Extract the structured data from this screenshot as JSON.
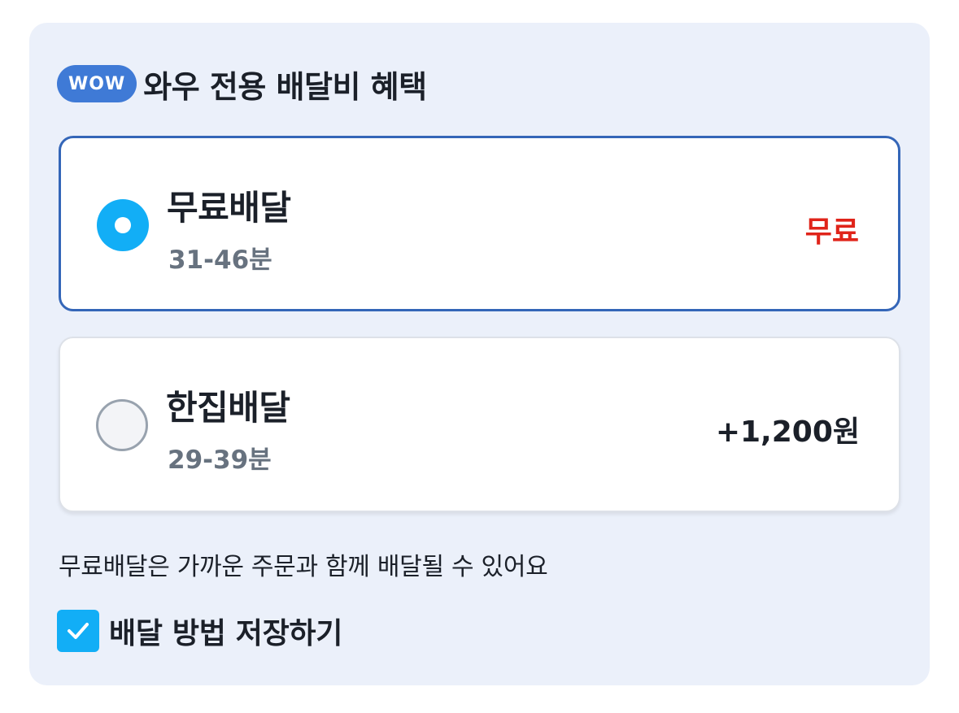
{
  "header": {
    "badge": "WOW",
    "title": "와우 전용 배달비 혜택"
  },
  "options": [
    {
      "name": "무료배달",
      "time": "31-46분",
      "price": "무료",
      "selected": true,
      "price_color": "#e0241a"
    },
    {
      "name": "한집배달",
      "time": "29-39분",
      "price": "+1,200원",
      "selected": false,
      "price_color": "#1b2029"
    }
  ],
  "note": "무료배달은 가까운 주문과 함께 배달될 수 있어요",
  "save": {
    "label": "배달 방법 저장하기",
    "checked": true
  },
  "colors": {
    "accent": "#12aef6",
    "selected_border": "#3466b8",
    "wow_badge": "#3f7ad6",
    "panel_bg": "#ebf0fa"
  }
}
